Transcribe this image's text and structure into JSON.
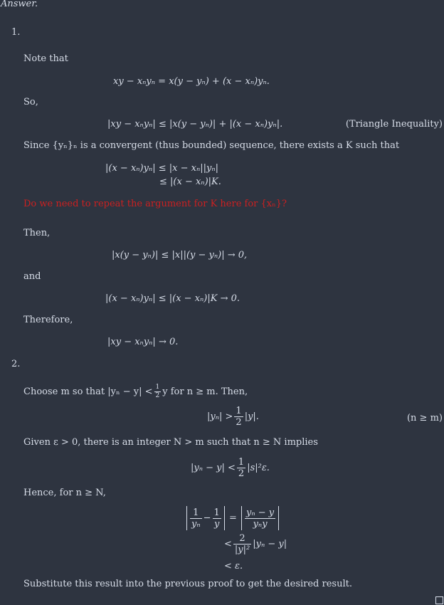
{
  "answer_label": "Answer.",
  "item1": {
    "number": "1.",
    "note_that": "Note that",
    "eq1": "xy − xₙyₙ = x(y − yₙ) + (x − xₙ)yₙ.",
    "so": "So,",
    "eq2": "|xy − xₙyₙ| ≤ |x(y − yₙ)| + |(x − xₙ)yₙ|.",
    "eq2_tag": "(Triangle Inequality)",
    "since_text": "Since {yₙ}ₙ is a convergent (thus bounded) sequence, there exists a K such that",
    "eq3_line1": "|(x − xₙ)yₙ| ≤ |x − xₙ||yₙ|",
    "eq3_line2": "≤ |(x − xₙ)|K.",
    "question": "Do we need to repeat the argument for K here for {xₙ}?",
    "then": "Then,",
    "eq4": "|x(y − yₙ)| ≤ |x||(y − yₙ)| → 0,",
    "and": "and",
    "eq5": "|(x − xₙ)yₙ| ≤ |(x − xₙ)|K → 0.",
    "therefore": "Therefore,",
    "eq6": "|xy − xₙyₙ| → 0."
  },
  "item2": {
    "number": "2.",
    "choose_text_a": "Choose m so that |yₙ − y| <",
    "choose_frac_num": "1",
    "choose_frac_den": "2",
    "choose_text_b": "y for n ≥ m. Then,",
    "eq7_lhs": "|yₙ| >",
    "eq7_frac_num": "1",
    "eq7_frac_den": "2",
    "eq7_rhs": "|y|.",
    "eq7_tag": "(n ≥ m)",
    "given_text": "Given ε > 0, there is an integer N > m such that n ≥ N implies",
    "eq8_lhs": "|yₙ − y| <",
    "eq8_frac_num": "1",
    "eq8_frac_den": "2",
    "eq8_rhs": "|s|²ε.",
    "hence": "Hence, for n ≥ N,",
    "eq9_f1_num": "1",
    "eq9_f1_den": "yₙ",
    "eq9_minus": "−",
    "eq9_f2_num": "1",
    "eq9_f2_den": "y",
    "eq9_eq": "=",
    "eq9_f3_num": "yₙ − y",
    "eq9_f3_den": "yₙy",
    "eq9_l2_lt": "<",
    "eq9_l2_num": "2",
    "eq9_l2_den": "|y|²",
    "eq9_l2_rest": "|yₙ − y|",
    "eq9_l3": "< ε.",
    "substitute": "Substitute this result into the previous proof to get the desired result."
  },
  "colors": {
    "background": "#2e3440",
    "text": "#d8dee9",
    "highlight": "#cc2020"
  }
}
